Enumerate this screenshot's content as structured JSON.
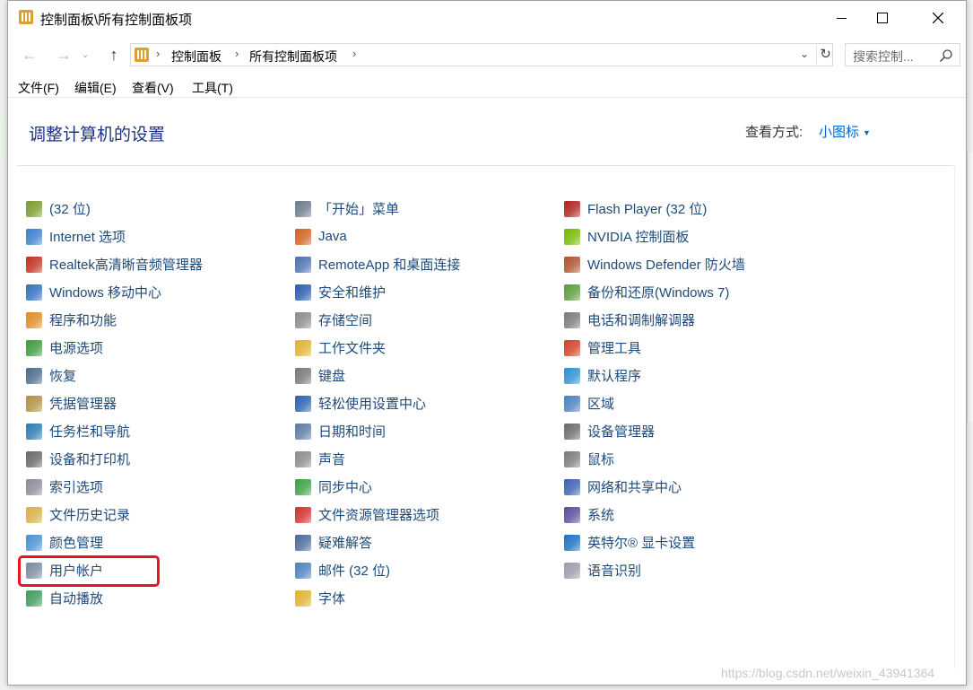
{
  "window": {
    "title": "控制面板\\所有控制面板项"
  },
  "nav": {
    "back": "←",
    "forward": "→",
    "recent": "⌄",
    "up": "↑",
    "breadcrumbs": [
      "控制面板",
      "所有控制面板项"
    ],
    "sep": "›",
    "dropdown": "⌄",
    "refresh": "↻",
    "search_placeholder": "搜索控制..."
  },
  "menu": [
    "文件(F)",
    "编辑(E)",
    "查看(V)",
    "工具(T)"
  ],
  "header": {
    "title": "调整计算机的设置",
    "view_label": "查看方式:",
    "view_value": "小图标"
  },
  "columns": [
    [
      {
        "label": "(32 位)",
        "icon": "java-config-icon",
        "color": "#7a9a2a"
      },
      {
        "label": "Internet 选项",
        "icon": "internet-options-icon",
        "color": "#3a7fd0"
      },
      {
        "label": "Realtek高清晰音频管理器",
        "icon": "speaker-icon",
        "color": "#c03020"
      },
      {
        "label": "Windows 移动中心",
        "icon": "mobility-center-icon",
        "color": "#3070c0"
      },
      {
        "label": "程序和功能",
        "icon": "programs-icon",
        "color": "#e08a20"
      },
      {
        "label": "电源选项",
        "icon": "power-icon",
        "color": "#3a9a3a"
      },
      {
        "label": "恢复",
        "icon": "recovery-icon",
        "color": "#4a6a8a"
      },
      {
        "label": "凭据管理器",
        "icon": "credential-icon",
        "color": "#b09040"
      },
      {
        "label": "任务栏和导航",
        "icon": "taskbar-icon",
        "color": "#2a7ab0"
      },
      {
        "label": "设备和打印机",
        "icon": "printer-icon",
        "color": "#666666"
      },
      {
        "label": "索引选项",
        "icon": "indexing-icon",
        "color": "#8a8a9a"
      },
      {
        "label": "文件历史记录",
        "icon": "file-history-icon",
        "color": "#d8b040"
      },
      {
        "label": "颜色管理",
        "icon": "color-management-icon",
        "color": "#4a90d0"
      },
      {
        "label": "用户帐户",
        "icon": "user-accounts-icon",
        "color": "#7a8aa0"
      },
      {
        "label": "自动播放",
        "icon": "autoplay-icon",
        "color": "#3a9a5a"
      }
    ],
    [
      {
        "label": "「开始」菜单",
        "icon": "start-menu-icon",
        "color": "#6a7a8a"
      },
      {
        "label": "Java",
        "icon": "java-icon",
        "color": "#d06020"
      },
      {
        "label": "RemoteApp 和桌面连接",
        "icon": "remoteapp-icon",
        "color": "#4a70b0"
      },
      {
        "label": "安全和维护",
        "icon": "security-flag-icon",
        "color": "#2a5ab0"
      },
      {
        "label": "存储空间",
        "icon": "storage-icon",
        "color": "#8a8a8a"
      },
      {
        "label": "工作文件夹",
        "icon": "work-folders-icon",
        "color": "#e0b030"
      },
      {
        "label": "键盘",
        "icon": "keyboard-icon",
        "color": "#777777"
      },
      {
        "label": "轻松使用设置中心",
        "icon": "ease-of-access-icon",
        "color": "#2a60b0"
      },
      {
        "label": "日期和时间",
        "icon": "date-time-icon",
        "color": "#5a7aa0"
      },
      {
        "label": "声音",
        "icon": "sound-icon",
        "color": "#8a8a8a"
      },
      {
        "label": "同步中心",
        "icon": "sync-center-icon",
        "color": "#3aa040"
      },
      {
        "label": "文件资源管理器选项",
        "icon": "explorer-options-icon",
        "color": "#d03030"
      },
      {
        "label": "疑难解答",
        "icon": "troubleshooting-icon",
        "color": "#4a6a9a"
      },
      {
        "label": "邮件 (32 位)",
        "icon": "mail-icon",
        "color": "#4a80c0"
      },
      {
        "label": "字体",
        "icon": "fonts-icon",
        "color": "#e0b030"
      }
    ],
    [
      {
        "label": "Flash Player (32 位)",
        "icon": "flash-player-icon",
        "color": "#b02020"
      },
      {
        "label": "NVIDIA 控制面板",
        "icon": "nvidia-icon",
        "color": "#76b900"
      },
      {
        "label": "Windows Defender 防火墙",
        "icon": "firewall-icon",
        "color": "#b05030"
      },
      {
        "label": "备份和还原(Windows 7)",
        "icon": "backup-icon",
        "color": "#5a9a3a"
      },
      {
        "label": "电话和调制解调器",
        "icon": "phone-modem-icon",
        "color": "#7a7a7a"
      },
      {
        "label": "管理工具",
        "icon": "admin-tools-icon",
        "color": "#d04020"
      },
      {
        "label": "默认程序",
        "icon": "default-programs-icon",
        "color": "#2a90d0"
      },
      {
        "label": "区域",
        "icon": "region-icon",
        "color": "#4a80c0"
      },
      {
        "label": "设备管理器",
        "icon": "device-manager-icon",
        "color": "#6a6a6a"
      },
      {
        "label": "鼠标",
        "icon": "mouse-icon",
        "color": "#7a7a7a"
      },
      {
        "label": "网络和共享中心",
        "icon": "network-icon",
        "color": "#3a60b0"
      },
      {
        "label": "系统",
        "icon": "system-icon",
        "color": "#5a4a9a"
      },
      {
        "label": "英特尔® 显卡设置",
        "icon": "intel-graphics-icon",
        "color": "#1a70c0"
      },
      {
        "label": "语音识别",
        "icon": "microphone-icon",
        "color": "#9a9aaa"
      }
    ]
  ],
  "watermark": "https://blog.csdn.net/weixin_43941364"
}
